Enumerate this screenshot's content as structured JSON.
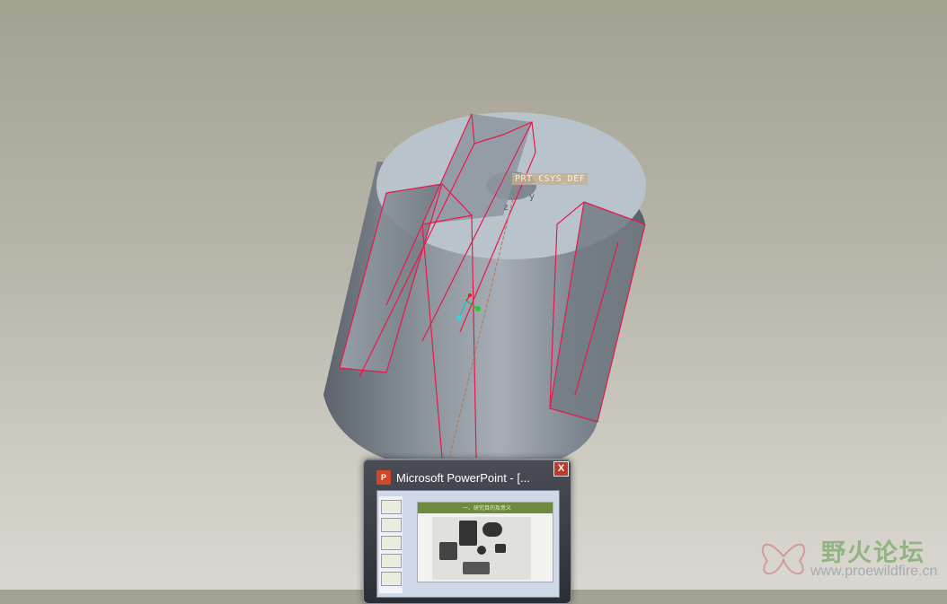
{
  "viewport": {
    "csys_label": "PRT_CSYS_DEF",
    "axis_y": "y",
    "axis_z": "z"
  },
  "taskbar_thumbnail": {
    "title": "Microsoft PowerPoint - [...",
    "close_symbol": "X",
    "preview_slide_title": "一、研究目的及意义"
  },
  "watermark": {
    "name": "野火论坛",
    "url": "www.proewildfire.cn"
  },
  "colors": {
    "background_top": "#a3a192",
    "background_bottom": "#d9d7cf",
    "model_face": "#b8c2cb",
    "model_side": "#808890",
    "highlight_edge": "#e8194a",
    "powerpoint_accent": "#d24726"
  }
}
